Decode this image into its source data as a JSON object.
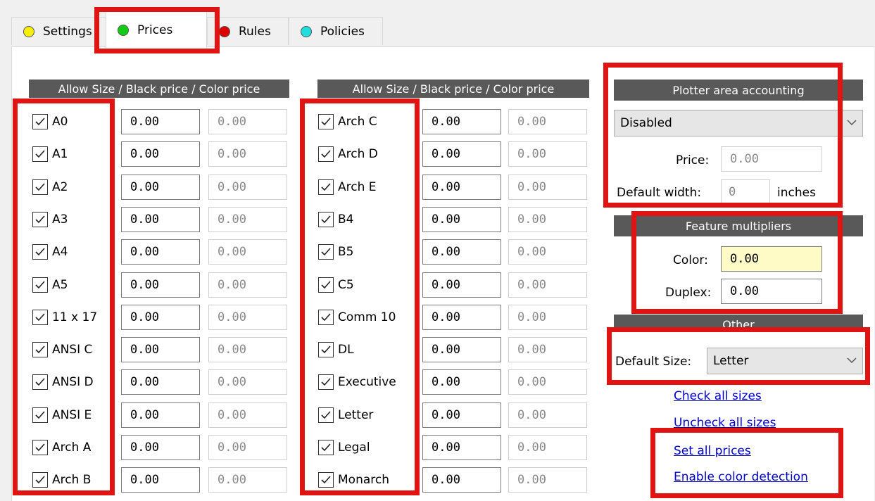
{
  "tabs": [
    {
      "label": "Settings",
      "color": "#f6f000",
      "active": false
    },
    {
      "label": "Prices",
      "color": "#11cc11",
      "active": true
    },
    {
      "label": "Rules",
      "color": "#dd0000",
      "active": false
    },
    {
      "label": "Policies",
      "color": "#22dddd",
      "active": false
    }
  ],
  "column_header": "Allow Size / Black price / Color price",
  "left_rows": [
    {
      "size": "A0",
      "checked": true,
      "black": "0.00",
      "color": "0.00"
    },
    {
      "size": "A1",
      "checked": true,
      "black": "0.00",
      "color": "0.00"
    },
    {
      "size": "A2",
      "checked": true,
      "black": "0.00",
      "color": "0.00"
    },
    {
      "size": "A3",
      "checked": true,
      "black": "0.00",
      "color": "0.00"
    },
    {
      "size": "A4",
      "checked": true,
      "black": "0.00",
      "color": "0.00"
    },
    {
      "size": "A5",
      "checked": true,
      "black": "0.00",
      "color": "0.00"
    },
    {
      "size": "11 x 17",
      "checked": true,
      "black": "0.00",
      "color": "0.00"
    },
    {
      "size": "ANSI C",
      "checked": true,
      "black": "0.00",
      "color": "0.00"
    },
    {
      "size": "ANSI D",
      "checked": true,
      "black": "0.00",
      "color": "0.00"
    },
    {
      "size": "ANSI E",
      "checked": true,
      "black": "0.00",
      "color": "0.00"
    },
    {
      "size": "Arch A",
      "checked": true,
      "black": "0.00",
      "color": "0.00"
    },
    {
      "size": "Arch B",
      "checked": true,
      "black": "0.00",
      "color": "0.00"
    }
  ],
  "right_rows": [
    {
      "size": "Arch C",
      "checked": true,
      "black": "0.00",
      "color": "0.00"
    },
    {
      "size": "Arch D",
      "checked": true,
      "black": "0.00",
      "color": "0.00"
    },
    {
      "size": "Arch E",
      "checked": true,
      "black": "0.00",
      "color": "0.00"
    },
    {
      "size": "B4",
      "checked": true,
      "black": "0.00",
      "color": "0.00"
    },
    {
      "size": "B5",
      "checked": true,
      "black": "0.00",
      "color": "0.00"
    },
    {
      "size": "C5",
      "checked": true,
      "black": "0.00",
      "color": "0.00"
    },
    {
      "size": "Comm 10",
      "checked": true,
      "black": "0.00",
      "color": "0.00"
    },
    {
      "size": "DL",
      "checked": true,
      "black": "0.00",
      "color": "0.00"
    },
    {
      "size": "Executive",
      "checked": true,
      "black": "0.00",
      "color": "0.00"
    },
    {
      "size": "Letter",
      "checked": true,
      "black": "0.00",
      "color": "0.00"
    },
    {
      "size": "Legal",
      "checked": true,
      "black": "0.00",
      "color": "0.00"
    },
    {
      "size": "Monarch",
      "checked": true,
      "black": "0.00",
      "color": "0.00"
    }
  ],
  "plotter": {
    "title": "Plotter area accounting",
    "mode": "Disabled",
    "price_label": "Price:",
    "price_value": "0.00",
    "width_label": "Default width:",
    "width_value": "0",
    "width_unit": "inches"
  },
  "features": {
    "title": "Feature multipliers",
    "color_label": "Color:",
    "color_value": "0.00",
    "duplex_label": "Duplex:",
    "duplex_value": "0.00"
  },
  "other": {
    "title": "Other",
    "default_size_label": "Default Size:",
    "default_size_value": "Letter"
  },
  "links": {
    "check_all": "Check all sizes",
    "uncheck_all": "Uncheck all sizes",
    "set_prices": "Set all prices",
    "color_detection": "Enable color detection"
  },
  "colors": {
    "highlight": "#e11414",
    "header_bg": "#595959",
    "link": "#0000cc",
    "highlight_field": "#fffbc7"
  }
}
